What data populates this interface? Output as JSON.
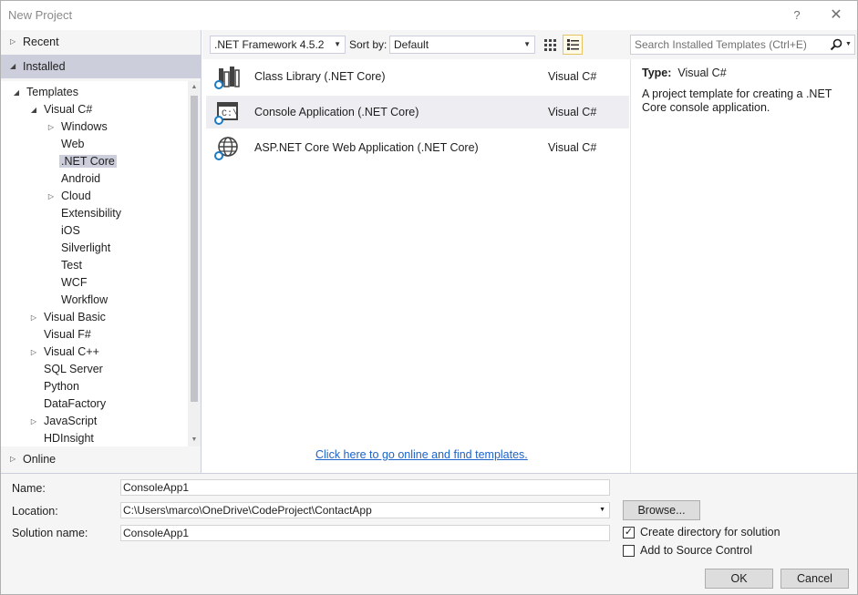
{
  "window": {
    "title": "New Project",
    "help_glyph": "?",
    "close_glyph": "✕"
  },
  "left_pane": {
    "recent": "Recent",
    "installed": "Installed",
    "online": "Online",
    "tree": [
      {
        "label": "Templates",
        "level": 0,
        "expander": "expanded"
      },
      {
        "label": "Visual C#",
        "level": 1,
        "expander": "expanded"
      },
      {
        "label": "Windows",
        "level": 2,
        "expander": "collapsed"
      },
      {
        "label": "Web",
        "level": 2,
        "expander": "none"
      },
      {
        "label": ".NET Core",
        "level": 2,
        "expander": "none",
        "selected": true
      },
      {
        "label": "Android",
        "level": 2,
        "expander": "none"
      },
      {
        "label": "Cloud",
        "level": 2,
        "expander": "collapsed"
      },
      {
        "label": "Extensibility",
        "level": 2,
        "expander": "none"
      },
      {
        "label": "iOS",
        "level": 2,
        "expander": "none"
      },
      {
        "label": "Silverlight",
        "level": 2,
        "expander": "none"
      },
      {
        "label": "Test",
        "level": 2,
        "expander": "none"
      },
      {
        "label": "WCF",
        "level": 2,
        "expander": "none"
      },
      {
        "label": "Workflow",
        "level": 2,
        "expander": "none"
      },
      {
        "label": "Visual Basic",
        "level": 1,
        "expander": "collapsed"
      },
      {
        "label": "Visual F#",
        "level": 1,
        "expander": "none"
      },
      {
        "label": "Visual C++",
        "level": 1,
        "expander": "collapsed"
      },
      {
        "label": "SQL Server",
        "level": 1,
        "expander": "none"
      },
      {
        "label": "Python",
        "level": 1,
        "expander": "none"
      },
      {
        "label": "DataFactory",
        "level": 1,
        "expander": "none"
      },
      {
        "label": "JavaScript",
        "level": 1,
        "expander": "collapsed"
      },
      {
        "label": "HDInsight",
        "level": 1,
        "expander": "none"
      }
    ]
  },
  "toolbar": {
    "framework": ".NET Framework 4.5.2",
    "sort_label": "Sort by:",
    "sort_value": "Default",
    "search_placeholder": "Search Installed Templates (Ctrl+E)"
  },
  "templates": [
    {
      "name": "Class Library (.NET Core)",
      "lang": "Visual C#",
      "icon": "class-library-icon",
      "selected": false
    },
    {
      "name": "Console Application (.NET Core)",
      "lang": "Visual C#",
      "icon": "console-app-icon",
      "selected": true
    },
    {
      "name": "ASP.NET Core Web Application (.NET Core)",
      "lang": "Visual C#",
      "icon": "web-app-icon",
      "selected": false
    }
  ],
  "online_link": "Click here to go online and find templates.",
  "details": {
    "type_label": "Type:",
    "type_value": "Visual C#",
    "description": "A project template for creating a .NET Core console application."
  },
  "form": {
    "name_label": "Name:",
    "name_value": "ConsoleApp1",
    "location_label": "Location:",
    "location_value": "C:\\Users\\marco\\OneDrive\\CodeProject\\ContactApp",
    "solution_label": "Solution name:",
    "solution_value": "ConsoleApp1",
    "browse": "Browse...",
    "create_dir": "Create directory for solution",
    "create_dir_checked": true,
    "add_source": "Add to Source Control",
    "add_source_checked": false,
    "ok": "OK",
    "cancel": "Cancel"
  },
  "colors": {
    "selection": "#cccedb",
    "link": "#1e63c8",
    "pane_bg": "#f5f5f5",
    "hover_row": "#eeeef2"
  }
}
